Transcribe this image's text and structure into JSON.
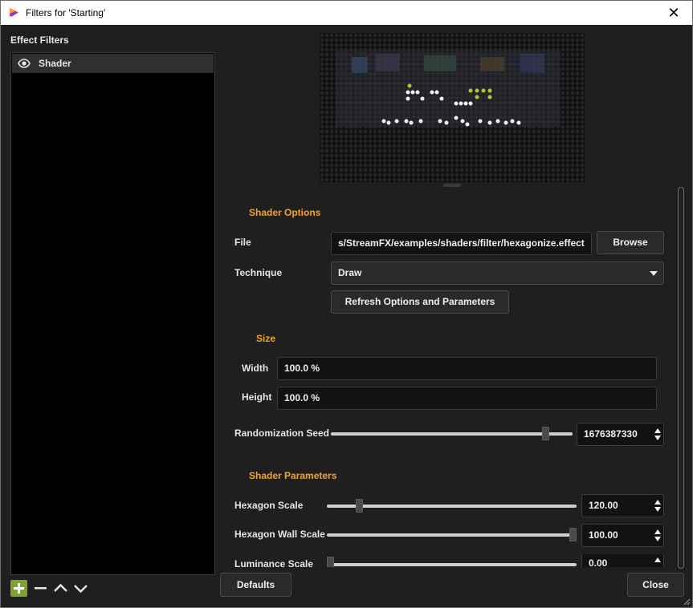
{
  "window": {
    "title": "Filters for 'Starting'",
    "close_glyph": "✕"
  },
  "left": {
    "heading": "Effect Filters",
    "filters": [
      {
        "name": "Shader",
        "icon": "eye-icon"
      }
    ],
    "buttons": {
      "add": "plus-icon",
      "remove": "minus-icon",
      "up": "chevron-up-icon",
      "down": "chevron-down-icon"
    }
  },
  "shader_options": {
    "heading": "Shader Options",
    "file_label": "File",
    "file_value": "s/StreamFX/examples/shaders/filter/hexagonize.effect",
    "browse_label": "Browse",
    "technique_label": "Technique",
    "technique_value": "Draw",
    "refresh_label": "Refresh Options and Parameters"
  },
  "size": {
    "heading": "Size",
    "width_label": "Width",
    "width_value": "100.0 %",
    "height_label": "Height",
    "height_value": "100.0 %"
  },
  "seed": {
    "label": "Randomization Seed",
    "value": "1676387330",
    "slider_fraction": 0.9
  },
  "shader_parameters": {
    "heading": "Shader Parameters",
    "items": [
      {
        "label": "Hexagon Scale",
        "value": "120.00",
        "slider_fraction": 0.12
      },
      {
        "label": "Hexagon Wall Scale",
        "value": "100.00",
        "slider_fraction": 1.0
      },
      {
        "label": "Luminance Scale",
        "value": "0.00",
        "slider_fraction": 0.0
      }
    ]
  },
  "footer": {
    "defaults_label": "Defaults",
    "close_label": "Close"
  },
  "colors": {
    "accent": "#f5a523",
    "add_button": "#7ea52a",
    "background": "#1f1f1f"
  }
}
